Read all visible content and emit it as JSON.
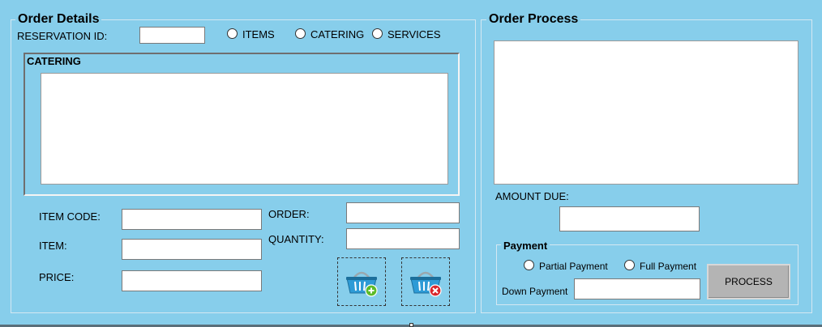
{
  "order_details": {
    "title": "Order Details",
    "reservation_id_label": "RESERVATION ID:",
    "reservation_id_value": "",
    "type_options": [
      "ITEMS",
      "CATERING",
      "SERVICES"
    ],
    "catering_group_title": "CATERING",
    "item_code_label": "ITEM CODE:",
    "item_label": "ITEM:",
    "price_label": "PRICE:",
    "order_label": "ORDER:",
    "quantity_label": "QUANTITY:",
    "add_icon": "basket-add-icon",
    "remove_icon": "basket-remove-icon"
  },
  "order_process": {
    "title": "Order Process",
    "amount_due_label": "AMOUNT DUE:",
    "payment": {
      "title": "Payment",
      "options": [
        "Partial Payment",
        "Full Payment"
      ],
      "down_payment_label": "Down Payment",
      "process_button": "PROCESS"
    }
  },
  "colors": {
    "background": "#87CEEB",
    "button": "#B4B4B4",
    "basket_blue": "#2E9BD6",
    "add_badge": "#5DBB2A",
    "remove_badge": "#D9262C"
  }
}
